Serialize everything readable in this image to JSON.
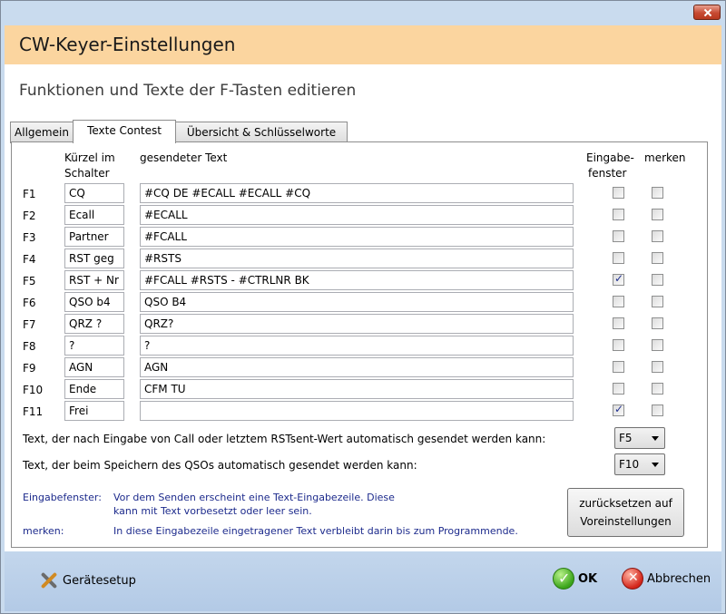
{
  "window": {
    "title": "CW-Keyer-Einstellungen"
  },
  "subtitle": "Funktionen und Texte der F-Tasten editieren",
  "tabs": [
    {
      "label": "Allgemein"
    },
    {
      "label": "Texte Contest"
    },
    {
      "label": "Übersicht & Schlüsselworte"
    }
  ],
  "columns": {
    "short_line1": "Kürzel im",
    "short_line2": "Schalter",
    "text": "gesendeter Text",
    "input_line1": "Eingabe-",
    "input_line2": "fenster",
    "remember": "merken"
  },
  "rows": [
    {
      "key": "F1",
      "short": "CQ",
      "text": "#CQ DE #ECALL #ECALL #CQ",
      "input": false,
      "remember": false
    },
    {
      "key": "F2",
      "short": "Ecall",
      "text": "#ECALL",
      "input": false,
      "remember": false
    },
    {
      "key": "F3",
      "short": "Partner",
      "text": "#FCALL",
      "input": false,
      "remember": false
    },
    {
      "key": "F4",
      "short": "RST geg",
      "text": "#RSTS",
      "input": false,
      "remember": false
    },
    {
      "key": "F5",
      "short": "RST + Nr",
      "text": "#FCALL #RSTS - #CTRLNR BK",
      "input": true,
      "remember": false
    },
    {
      "key": "F6",
      "short": "QSO b4",
      "text": "QSO B4",
      "input": false,
      "remember": false
    },
    {
      "key": "F7",
      "short": "QRZ ?",
      "text": "QRZ?",
      "input": false,
      "remember": false
    },
    {
      "key": "F8",
      "short": "?",
      "text": "?",
      "input": false,
      "remember": false
    },
    {
      "key": "F9",
      "short": "AGN",
      "text": "AGN",
      "input": false,
      "remember": false
    },
    {
      "key": "F10",
      "short": "Ende",
      "text": "CFM TU",
      "input": false,
      "remember": false
    },
    {
      "key": "F11",
      "short": "Frei",
      "text": "",
      "input": true,
      "remember": false
    }
  ],
  "auto_after_call": {
    "label": "Text, der nach Eingabe von Call oder letztem RSTsent-Wert automatisch gesendet werden kann:",
    "value": "F5"
  },
  "auto_on_save": {
    "label": "Text, der beim Speichern des QSOs  automatisch gesendet werden kann:",
    "value": "F10"
  },
  "info": {
    "input_label": "Eingabefenster:",
    "input_line1": "Vor dem Senden erscheint eine Text-Eingabezeile. Diese",
    "input_line2": "kann mit Text vorbesetzt oder leer sein.",
    "remember_label": "merken:",
    "remember_text": "In diese Eingabezeile eingetragener Text verbleibt darin bis zum Programmende."
  },
  "reset_button": {
    "line1": "zurücksetzen auf",
    "line2": "Voreinstellungen"
  },
  "footer": {
    "setup": "Gerätesetup",
    "ok": "OK",
    "cancel": "Abbrechen"
  }
}
